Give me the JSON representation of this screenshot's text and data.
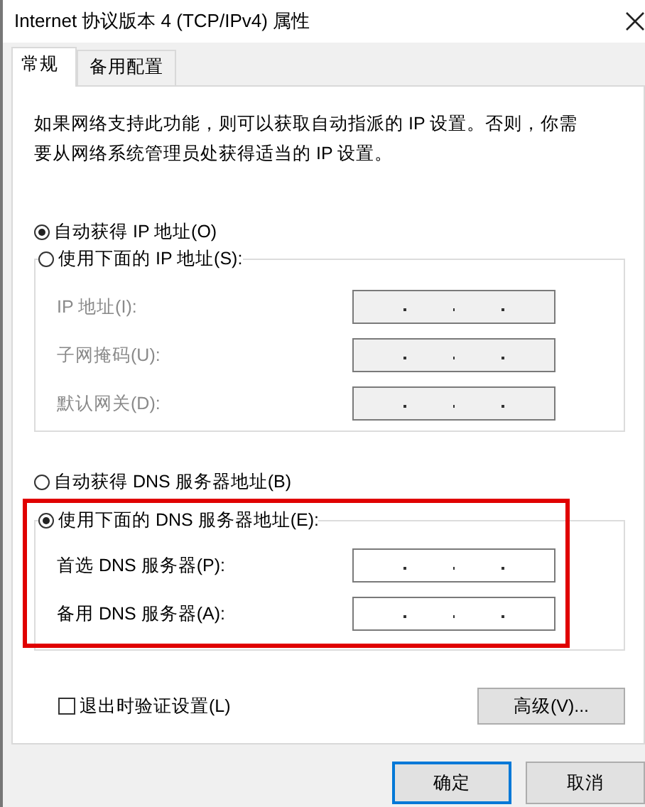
{
  "window": {
    "title": "Internet 协议版本 4 (TCP/IPv4) 属性"
  },
  "tabs": [
    {
      "label": "常规",
      "selected": true
    },
    {
      "label": "备用配置",
      "selected": false
    }
  ],
  "description": "如果网络支持此功能，则可以获取自动指派的 IP 设置。否则，你需要从网络系统管理员处获得适当的 IP 设置。",
  "ip_section": {
    "options": [
      {
        "label": "自动获得 IP 地址(O)",
        "selected": true
      },
      {
        "label": "使用下面的 IP 地址(S):",
        "selected": false
      }
    ],
    "fields": [
      {
        "label": "IP 地址(I):",
        "disabled": true
      },
      {
        "label": "子网掩码(U):",
        "disabled": true
      },
      {
        "label": "默认网关(D):",
        "disabled": true
      }
    ]
  },
  "dns_section": {
    "highlighted": true,
    "options": [
      {
        "label": "自动获得 DNS 服务器地址(B)",
        "selected": false
      },
      {
        "label": "使用下面的 DNS 服务器地址(E):",
        "selected": true
      }
    ],
    "fields": [
      {
        "label": "首选 DNS 服务器(P):",
        "disabled": false
      },
      {
        "label": "备用 DNS 服务器(A):",
        "disabled": false
      }
    ]
  },
  "validate_checkbox": {
    "label": "退出时验证设置(L)",
    "checked": false
  },
  "advanced_button": "高级(V)...",
  "buttons": [
    {
      "label": "确定",
      "focused": true
    },
    {
      "label": "取消",
      "focused": false
    }
  ]
}
